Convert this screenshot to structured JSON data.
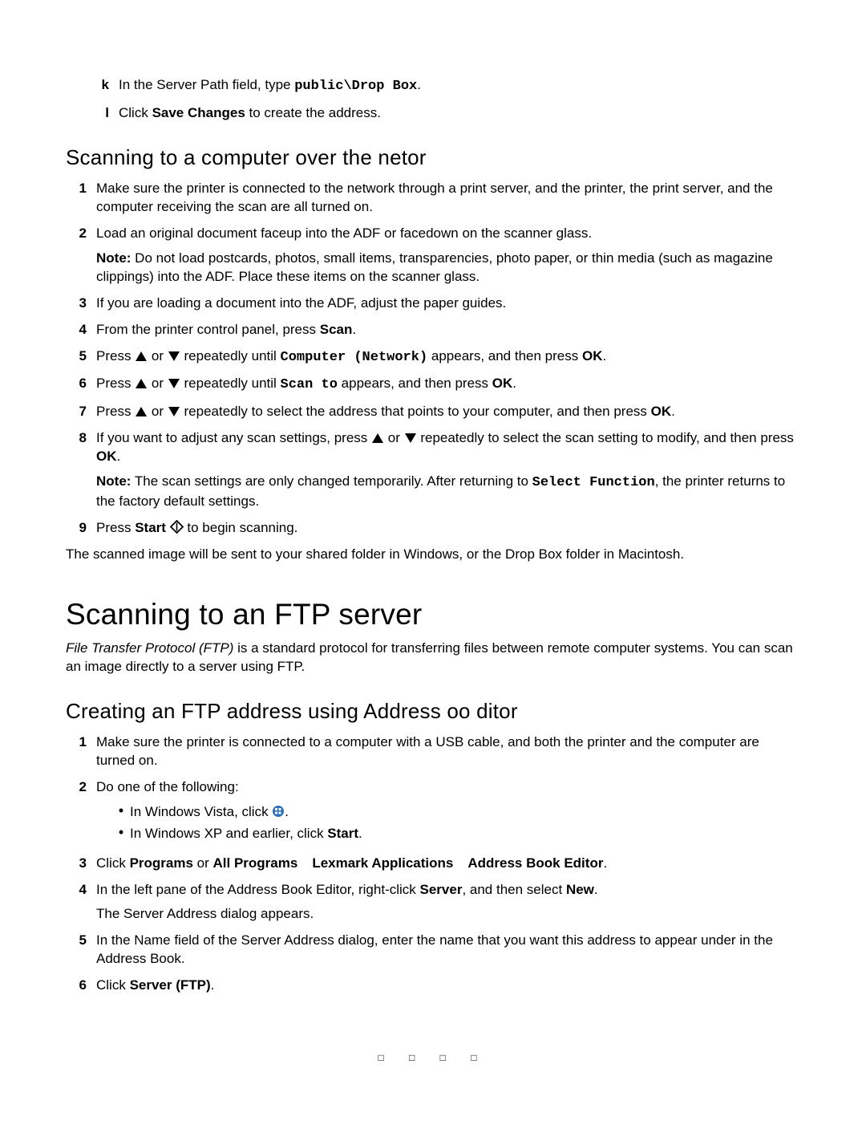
{
  "intro": {
    "k": {
      "marker": "k",
      "pre": "In the Server Path field, type ",
      "code": "public\\Drop Box",
      "post": "."
    },
    "l": {
      "marker": "l",
      "pre": "Click ",
      "bold": "Save Changes",
      "post": " to create the address."
    }
  },
  "sec1": {
    "heading": "Scanning to a computer over the netor",
    "i1": {
      "marker": "1",
      "text": "Make sure the printer is connected to the network through a print server, and the printer, the print server, and the computer receiving the scan are all turned on."
    },
    "i2": {
      "marker": "2",
      "text": "Load an original document faceup into the ADF or facedown on the scanner glass.",
      "note_label": "Note:",
      "note": " Do not load postcards, photos, small items, transparencies, photo paper, or thin media (such as magazine clippings) into the ADF. Place these items on the scanner glass."
    },
    "i3": {
      "marker": "3",
      "text": "If you are loading a document into the ADF, adjust the paper guides."
    },
    "i4": {
      "marker": "4",
      "pre": "From the printer control panel, press ",
      "bold": "Scan",
      "post": "."
    },
    "i5": {
      "marker": "5",
      "pre": "Press ",
      "or": " or ",
      "mid": " repeatedly until ",
      "code": "Computer (Network)",
      "post1": " appears, and then press ",
      "ok": "OK",
      "post2": "."
    },
    "i6": {
      "marker": "6",
      "pre": "Press ",
      "or": " or ",
      "mid": " repeatedly until ",
      "code": "Scan to",
      "post1": " appears, and then press ",
      "ok": "OK",
      "post2": "."
    },
    "i7": {
      "marker": "7",
      "pre": "Press ",
      "or": " or ",
      "mid": " repeatedly to select the address that points to your computer, and then press ",
      "ok": "OK",
      "post": "."
    },
    "i8": {
      "marker": "8",
      "pre": "If you want to adjust any scan settings, press ",
      "or": " or ",
      "mid": " repeatedly to select the scan setting to modify, and then press ",
      "ok": "OK",
      "post": ".",
      "note_label": "Note:",
      "note_pre": " The scan settings are only changed temporarily. After returning to ",
      "note_code": "Select Function",
      "note_post": ", the printer returns to the factory default settings."
    },
    "i9": {
      "marker": "9",
      "pre": "Press ",
      "bold": "Start",
      "sp": " ",
      "post": " to begin scanning."
    },
    "after": "The scanned image will be sent to your shared folder in Windows, or the Drop Box folder in Macintosh."
  },
  "sec2": {
    "heading": "Scanning to an FTP server",
    "intro_pre": "File Transfer Protocol (FTP)",
    "intro_post": " is a standard protocol for transferring files between remote computer systems. You can scan an image directly to a server using FTP.",
    "sub_heading": "Creating an FTP address using Address oo ditor",
    "i1": {
      "marker": "1",
      "text": "Make sure the printer is connected to a computer with a USB cable, and both the printer and the computer are turned on."
    },
    "i2": {
      "marker": "2",
      "text": "Do one of the following:",
      "b1_pre": "In Windows Vista, click ",
      "b1_post": ".",
      "b2_pre": "In Windows XP and earlier, click ",
      "b2_bold": "Start",
      "b2_post": "."
    },
    "i3": {
      "marker": "3",
      "pre": "Click ",
      "p1": "Programs",
      "or": " or ",
      "p2": "All Programs",
      "p3": "Lexmark Applications",
      "p4": "Address Book Editor",
      "post": "."
    },
    "i4": {
      "marker": "4",
      "pre": "In the left pane of the Address Book Editor, right-click ",
      "b1": "Server",
      "mid": ", and then select ",
      "b2": "New",
      "post": ".",
      "after": "The Server Address dialog appears."
    },
    "i5": {
      "marker": "5",
      "text": "In the Name field of the Server Address dialog, enter the name that you want this address to appear under in the Address Book."
    },
    "i6": {
      "marker": "6",
      "pre": "Click ",
      "bold": "Server (FTP)",
      "post": "."
    }
  },
  "footer": "□ □ □ □"
}
